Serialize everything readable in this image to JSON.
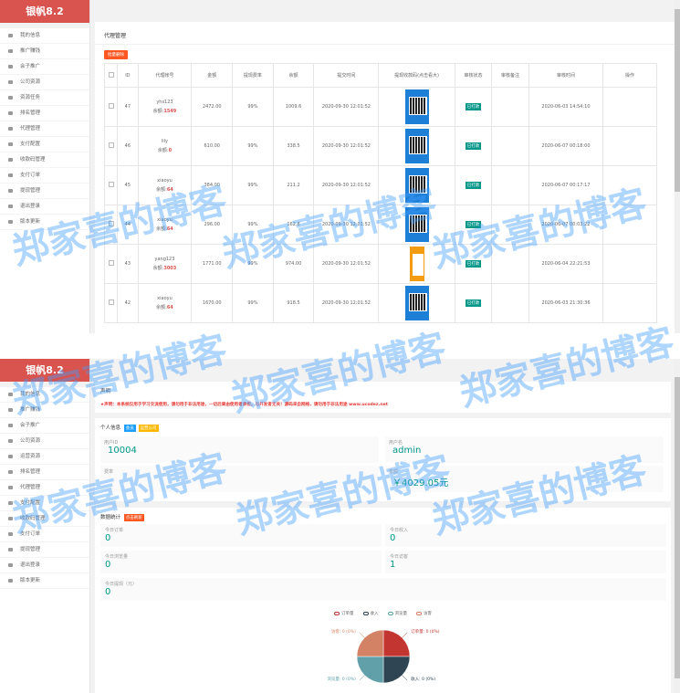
{
  "sidebar": {
    "brand": "银帆8.2",
    "items_top": [
      "我的信息",
      "推广赚钱",
      "会子推广",
      "公司资源",
      "资源任务",
      "排名管理",
      "代理管理",
      "支付配置",
      "收款码管理",
      "支付订单",
      "提现管理",
      "退出登录",
      "版本更新"
    ],
    "items_bottom": [
      "我的信息",
      "推广赚钱",
      "会子推广",
      "公司资源",
      "运营资源",
      "排名管理",
      "代理管理",
      "支付配置",
      "收款码管理",
      "支付订单",
      "提现管理",
      "退出登录",
      "版本更新"
    ]
  },
  "agents": {
    "title": "代理管理",
    "button": "批量删除",
    "headers": [
      "ID",
      "代理帐号",
      "金额",
      "提现费率",
      "余额",
      "提交时间",
      "提现收款码(点击看大)",
      "审核状态",
      "审核备注",
      "审核时间",
      "操作"
    ],
    "balance_prefix": "余额:",
    "rows": [
      {
        "id": "47",
        "account": "yhs123",
        "balance": "1549",
        "amount": "2472.00",
        "rate": "99%",
        "remain": "1009.6",
        "submit": "2020-09-30 12:01:52",
        "status": "已打款",
        "audit_time": "2020-06-03 14:54:10",
        "qr": "blue"
      },
      {
        "id": "46",
        "account": "lily",
        "balance": "0",
        "amount": "610.00",
        "rate": "99%",
        "remain": "338.5",
        "submit": "2020-09-30 12:01:52",
        "status": "已打款",
        "audit_time": "2020-06-07 00:18:00",
        "qr": "blue"
      },
      {
        "id": "45",
        "account": "xiaoyu",
        "balance": "64",
        "amount": "384.00",
        "rate": "99%",
        "remain": "211.2",
        "submit": "2020-09-30 12:01:52",
        "status": "已打款",
        "audit_time": "2020-06-07 00:17:17",
        "qr": "blue"
      },
      {
        "id": "44",
        "account": "xiaoyu",
        "balance": "64",
        "amount": "296.00",
        "rate": "99%",
        "remain": "162.8",
        "submit": "2020-09-30 12:01:52",
        "status": "已打款",
        "audit_time": "2020-06-07 00:03:22",
        "qr": "blue"
      },
      {
        "id": "43",
        "account": "yang123",
        "balance": "3003",
        "amount": "1771.00",
        "rate": "99%",
        "remain": "974.00",
        "submit": "2020-09-30 12:01:52",
        "status": "已打款",
        "audit_time": "2020-06-04 22:21:53",
        "qr": "orange"
      },
      {
        "id": "42",
        "account": "xiaoyu",
        "balance": "64",
        "amount": "1670.00",
        "rate": "99%",
        "remain": "918.5",
        "submit": "2020-09-30 12:01:52",
        "status": "已打款",
        "audit_time": "2020-06-03 21:30:36",
        "qr": "blue"
      }
    ]
  },
  "dashboard": {
    "notice_title": "声明",
    "notice_text": "★声明：本系统仅用于学习交流使用，请勿用于非法用途，一切后果由使用者承担，与开发者无关！源码来自网络，请勿用于非法用途 www.ucodez.net",
    "info_title": "个人信息",
    "tag_vip": "会员",
    "tag_level": "运营公司",
    "uid_label": "用户ID",
    "uid": "10004",
    "user_label": "用户名",
    "username": "admin",
    "fee_label": "费率",
    "balance_label": "余额",
    "balance": "￥4029.05元",
    "stats_title": "数据统计",
    "stats_tag": "点击刷新",
    "orders_label": "今日订单",
    "orders": "0",
    "income_label": "今日收入",
    "income": "0",
    "views_label": "今日浏览量",
    "views": "0",
    "visitors_label": "今日访客",
    "visitors": "1",
    "withdraw_label": "今日提现（元）",
    "withdraw": "0"
  },
  "chart_data": {
    "type": "pie",
    "legend": [
      "订单量",
      "收入",
      "浏览量",
      "访客"
    ],
    "labels": [
      "订单量: 0 (0%)",
      "收入: 0 (0%)",
      "浏览量: 0 (0%)",
      "访客: 0 (0%)"
    ],
    "values": [
      0,
      0,
      0,
      0
    ],
    "colors": [
      "#c23531",
      "#2f4554",
      "#61a0a8",
      "#d48265"
    ]
  },
  "watermark": "郑家喜的博客"
}
